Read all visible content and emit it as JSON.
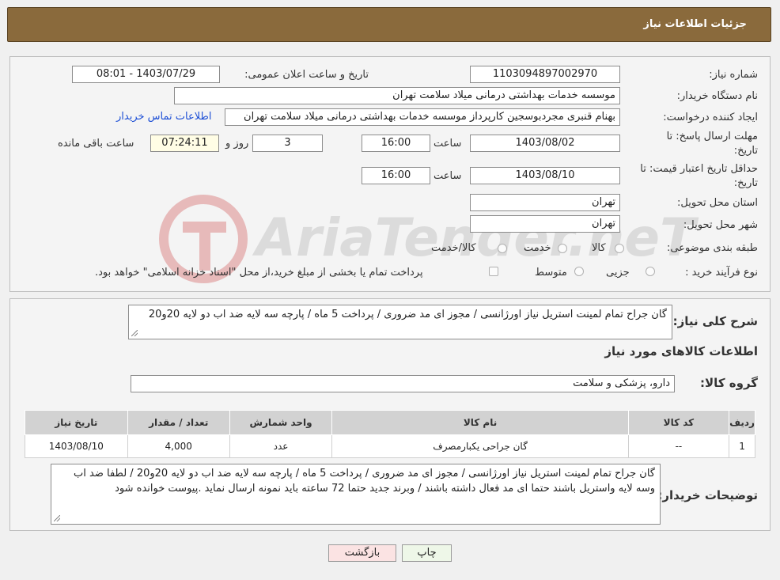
{
  "header": {
    "title": "جزئیات اطلاعات نیاز"
  },
  "form": {
    "need_number_label": "شماره نیاز:",
    "need_number": "1103094897002970",
    "announce_label": "تاریخ و ساعت اعلان عمومی:",
    "announce_value": "1403/07/29 - 08:01",
    "buyer_org_label": "نام دستگاه خریدار:",
    "buyer_org": "موسسه خدمات بهداشتی درمانی میلاد سلامت تهران",
    "creator_label": "ایجاد کننده درخواست:",
    "creator": "بهنام قنبری مجردبوسجین کارپرداز موسسه خدمات بهداشتی درمانی میلاد سلامت تهران",
    "contact_link": "اطلاعات تماس خریدار",
    "deadline_label_1": "مهلت ارسال پاسخ: تا",
    "deadline_label_2": "تاریخ:",
    "deadline_date": "1403/08/02",
    "time_label": "ساعت",
    "deadline_time": "16:00",
    "days_value": "3",
    "days_label": "روز و",
    "remaining_time": "07:24:11",
    "remaining_label": "ساعت باقی مانده",
    "validity_label_1": "حداقل تاریخ اعتبار قیمت: تا",
    "validity_label_2": "تاریخ:",
    "validity_date": "1403/08/10",
    "validity_time_label": "ساعت",
    "validity_time": "16:00",
    "province_label": "استان محل تحویل:",
    "province": "تهران",
    "city_label": "شهر محل تحویل:",
    "city": "تهران",
    "category_label": "طبقه بندی موضوعی:",
    "category_options": [
      "کالا",
      "خدمت",
      "کالا/خدمت"
    ],
    "process_label": "نوع فرآیند خرید :",
    "process_options": [
      "جزیی",
      "متوسط"
    ],
    "process_note": "پرداخت تمام یا بخشی از مبلغ خرید،از محل \"اسناد خزانه اسلامی\" خواهد بود."
  },
  "summary": {
    "label": "شرح کلی نیاز:",
    "text": "گان جراح تمام لمینت استریل  نیاز اورژانسی  / مجوز ای مد ضروری / پرداخت 5 ماه / پارچه سه لایه ضد اب دو لایه 20و20",
    "goods_info_title": "اطلاعات کالاهای مورد نیاز",
    "goods_group_label": "گروه کالا:",
    "goods_group": "دارو، پزشکی و سلامت"
  },
  "table": {
    "headers": [
      "ردیف",
      "کد کالا",
      "نام کالا",
      "واحد شمارش",
      "تعداد / مقدار",
      "تاریخ نیاز"
    ],
    "rows": [
      [
        "1",
        "--",
        "گان جراحی یکبارمصرف",
        "عدد",
        "4,000",
        "1403/08/10"
      ]
    ]
  },
  "buyer_notes": {
    "label": "توضیحات خریدار:",
    "text": "گان جراح تمام لمینت استریل  نیاز اورژانسی  / مجوز ای مد ضروری / پرداخت 5 ماه / پارچه سه لایه ضد اب  دو لایه 20و20 / لطفا ضد اب وسه لایه واستریل باشند حتما ای مد فعال داشته باشند / وبرند جدید حتما 72 ساعته باید نمونه ارسال نماید .پیوست خوانده شود"
  },
  "buttons": {
    "print": "چاپ",
    "back": "بازگشت"
  },
  "watermark": {
    "text": "AriaTender.neT"
  },
  "colors": {
    "header_bg": "#8a6a3c",
    "link": "#1d4fd6",
    "back_btn_bg": "#fbe3e3",
    "print_btn_bg": "#eef7e8"
  }
}
